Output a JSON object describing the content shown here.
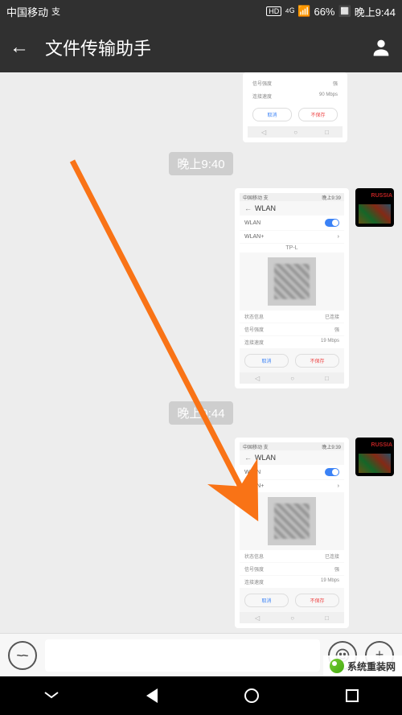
{
  "status": {
    "carrier": "中国移动",
    "hd": "HD",
    "signal": "⁴ᴳ",
    "battery": "66%",
    "time": "晚上9:44"
  },
  "header": {
    "title": "文件传输助手"
  },
  "chat": {
    "ts1": "晚上9:40",
    "ts2": "晚上9:44",
    "avatar_text": "RUSSIA",
    "mini": {
      "wlan": "WLAN",
      "wlan_plus": "WLAN+",
      "ssid": "TP-L",
      "status_label": "状态信息",
      "status_val": "已连接",
      "signal_label": "信号强度",
      "signal_val": "强",
      "speed_label": "连接速度",
      "speed_val": "19 Mbps",
      "speed_val_alt": "90 Mbps",
      "cancel": "取消",
      "forget": "不保存"
    }
  },
  "watermark": "系统重装网"
}
